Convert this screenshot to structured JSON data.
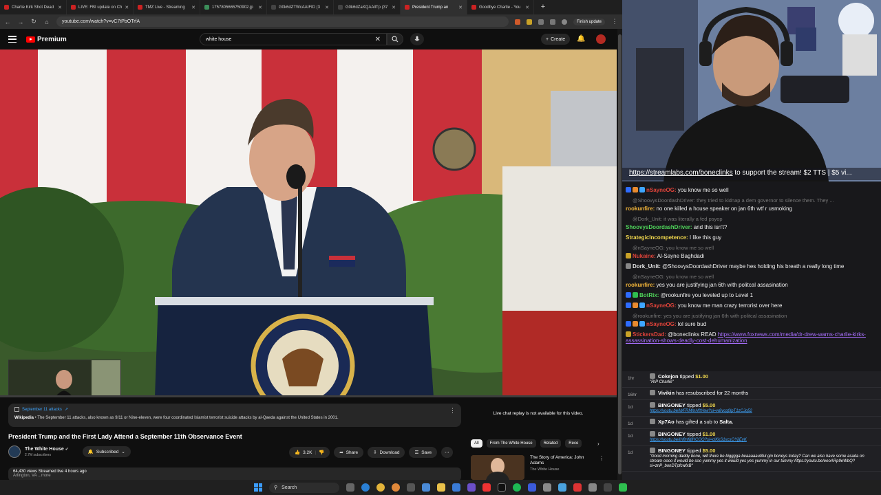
{
  "browser": {
    "tabs": [
      {
        "label": "Charlie Kirk Shot Dead",
        "color": "#cc2222",
        "active": false
      },
      {
        "label": "LIVE: FBI update on Ch",
        "color": "#cc2222",
        "active": false
      },
      {
        "label": "TMZ Live - Streaming",
        "color": "#cc2222",
        "active": false
      },
      {
        "label": "1757805665750902.jp",
        "color": "#3c8f5a",
        "active": false
      },
      {
        "label": "G0k6dZTWcAAIFID (3",
        "color": "#444444",
        "active": false
      },
      {
        "label": "G0k6dZaXQAAllTp (37",
        "color": "#444444",
        "active": false
      },
      {
        "label": "President Trump an",
        "color": "#cc2222",
        "active": true
      },
      {
        "label": "Goodbye Charlie - You",
        "color": "#cc2222",
        "active": false
      }
    ],
    "url": "youtube.com/watch?v=vC7tPbOTrfA",
    "finish_update": "Finish update"
  },
  "youtube": {
    "logo": "Premium",
    "search_query": "white house",
    "create_label": "Create",
    "info_card": {
      "title": "September 11 attacks",
      "source": "Wikipedia",
      "text": " • The September 11 attacks, also known as 9/11 or Nine-eleven, were four coordinated Islamist terrorist suicide attacks by al-Qaeda against the United States in 2001."
    },
    "video_title": "President Trump and the First Lady Attend a September 11th Observance Event",
    "channel_name": "The White House",
    "subscribers": "2.7M subscribers",
    "subscribed_label": "Subscribed",
    "likes": "3.2K",
    "share_label": "Share",
    "download_label": "Download",
    "save_label": "Save",
    "views_line": "64,430 views  Streamed live 4 hours ago",
    "location_line": "Arlington, VA  ...more",
    "chat_replay_note": "Live chat replay is not available for this video.",
    "chips": [
      "All",
      "From The White House",
      "Related",
      "Rece"
    ],
    "recommendation": {
      "title": "The Story of America: John Adams",
      "channel": "The White House"
    },
    "progress": 0.0
  },
  "stream": {
    "banner_link": "https://streamlabs.com/boneclinks",
    "banner_text": " to support the stream! $2 TTS | $5 vi..."
  },
  "chat": [
    {
      "type": "msg",
      "user": "nSayneOG",
      "color": "#e0433a",
      "text": " you know me so well",
      "badges": [
        "#2e6cff",
        "#e88a2e",
        "#3ea6ff"
      ]
    },
    {
      "type": "reply",
      "text": "@ShoovysDoordashDriver: they tried to kidnap a dem governor to silence them. They ..."
    },
    {
      "type": "msg",
      "user": "rookunfire",
      "color": "#f2b53a",
      "text": " no one killed a house speaker on jan 6th wtf r usmoking",
      "badges": []
    },
    {
      "type": "reply",
      "text": "@Dork_Unit: it was literally a fed psyop"
    },
    {
      "type": "msg",
      "user": "ShoovysDoordashDriver",
      "color": "#4fd35a",
      "text": " and this isn't?",
      "badges": []
    },
    {
      "type": "msg",
      "user": "StrategicIncompetence",
      "color": "#f2d94e",
      "text": " I like this guy",
      "badges": []
    },
    {
      "type": "reply",
      "text": "@nSayneOG: you know me so well"
    },
    {
      "type": "msg",
      "user": "Nukaine",
      "color": "#e0433a",
      "text": " Al-Sayne Baghdadi",
      "badges": [
        "#c9a227"
      ]
    },
    {
      "type": "msg",
      "user": "Dork_Unit",
      "color": "#e8e8e8",
      "text": " @ShoovysDoordashDriver maybe hes holding his breath a really long time",
      "badges": [
        "#888888"
      ]
    },
    {
      "type": "reply",
      "text": "@nSayneOG: you know me so well"
    },
    {
      "type": "msg",
      "user": "rookunfire",
      "color": "#f2b53a",
      "text": " yes you are justifying jan 6th with politcal assasination",
      "badges": []
    },
    {
      "type": "msg",
      "user": "BotRix",
      "color": "#4fd35a",
      "text": " @rookunfire you leveled up to Level 1",
      "badges": [
        "#2e6cff",
        "#2fbf4f"
      ]
    },
    {
      "type": "msg",
      "user": "nSayneOG",
      "color": "#e0433a",
      "text": " you know me man crazy terrorist over here",
      "badges": [
        "#2e6cff",
        "#e88a2e",
        "#3ea6ff"
      ]
    },
    {
      "type": "reply",
      "text": "@rookunfire: yes you are justifying jan 6th with politcal assasination"
    },
    {
      "type": "msg",
      "user": "nSayneOG",
      "color": "#e0433a",
      "text": " lol sure bud",
      "badges": [
        "#2e6cff",
        "#e88a2e",
        "#3ea6ff"
      ]
    },
    {
      "type": "link",
      "user": "StickersDad",
      "color": "#e0433a",
      "text": " @boneclinks READ ",
      "link": "https://www.foxnews.com/media/dr-drew-warns-charlie-kirks-assassination-shows-deadly-cost-dehumanization",
      "badges": [
        "#c9a227"
      ]
    }
  ],
  "events": [
    {
      "time": "1hr",
      "name": "Cokejon",
      "action": " tipped ",
      "amount": "$1.00",
      "note": "\"RIP Charlie\"",
      "link": false
    },
    {
      "time": "16hr",
      "name": "Vivikin",
      "action": " has resubscribed for 22 months",
      "amount": "",
      "note": "",
      "link": false
    },
    {
      "time": "1d",
      "name": "BINGONEY",
      "action": " tipped ",
      "amount": "$5.00",
      "note": "https://youtu.be/WFRMmHftYew?si=w8vcg0lpT1zCJq52",
      "link": true
    },
    {
      "time": "1d",
      "name": "Xp7Ao",
      "action": " has gifted a sub to ",
      "amount": "",
      "note": "",
      "link": false,
      "target": "Salta."
    },
    {
      "time": "1d",
      "name": "BINGONEY",
      "action": " tipped ",
      "amount": "$1.00",
      "note": "https://youtu.be/IHfmfdlHCOQ?si=clKkS1xcsOYjjEyK",
      "link": true
    },
    {
      "time": "1d",
      "name": "BINGONEY",
      "action": " tipped ",
      "amount": "$5.00",
      "note": "\"Good morning daddy bone, will there be bigggga beaaaaautiful gin boneys today? Can we also have some asada on stream oooo it would be soo yummy yes it would yes yes yummy in our tummy https://youtu.be/eeoARp9eWbQ?si=znP_bonDTpfcwfxB\"",
      "link": false
    }
  ],
  "taskbar": {
    "search_label": "Search"
  },
  "colors": {
    "accent": "#ff0000",
    "link": "#3ea6ff",
    "twitch_purple": "#a970ff"
  }
}
